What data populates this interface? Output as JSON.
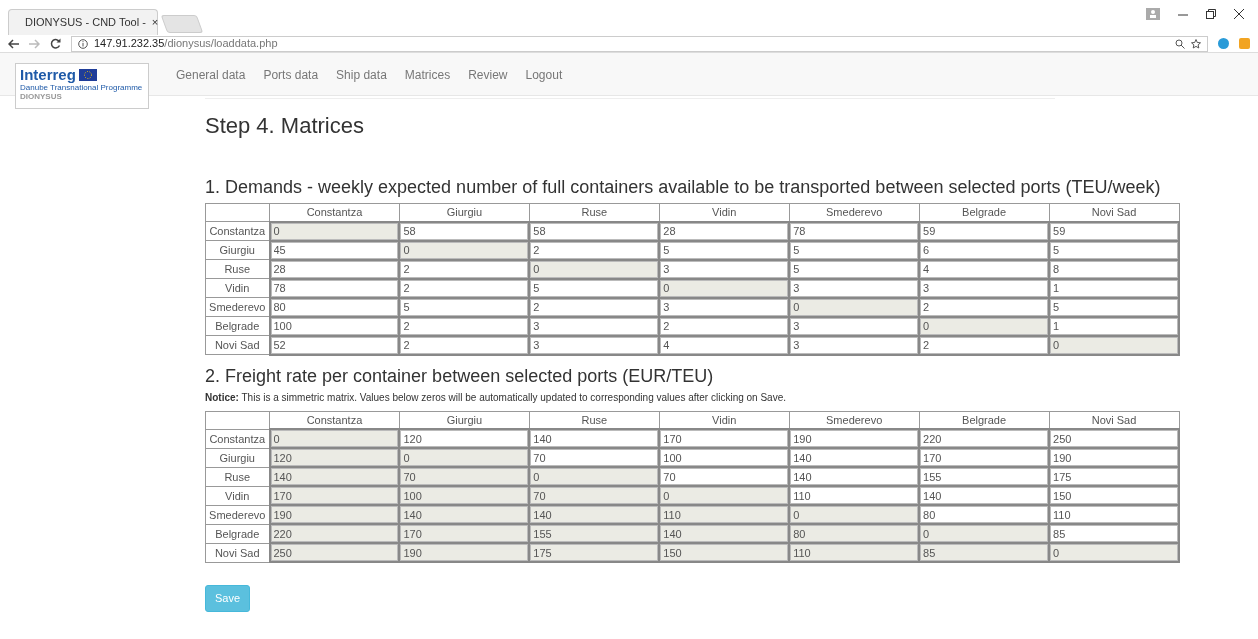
{
  "browser": {
    "tab_title": "DIONYSUS - CND Tool -",
    "tab_close": "×",
    "url_host": "147.91.232.35",
    "url_path": "/dionysus/loaddata.php"
  },
  "logo": {
    "name": "Interreg",
    "programme": "Danube Transnational Programme",
    "project": "DIONYSUS"
  },
  "nav": [
    {
      "label": "General data"
    },
    {
      "label": "Ports data"
    },
    {
      "label": "Ship data"
    },
    {
      "label": "Matrices"
    },
    {
      "label": "Review"
    },
    {
      "label": "Logout"
    }
  ],
  "page_title": "Step 4. Matrices",
  "sections": [
    {
      "heading": "1. Demands - weekly expected number of full containers available to be transported between selected ports (TEU/week)",
      "columns": [
        "Constantza",
        "Giurgiu",
        "Ruse",
        "Vidin",
        "Smederevo",
        "Belgrade",
        "Novi Sad"
      ],
      "rows": [
        {
          "label": "Constantza",
          "cells": [
            {
              "value": "0",
              "disabled": true
            },
            {
              "value": "58",
              "disabled": false
            },
            {
              "value": "58",
              "disabled": false
            },
            {
              "value": "28",
              "disabled": false
            },
            {
              "value": "78",
              "disabled": false
            },
            {
              "value": "59",
              "disabled": false
            },
            {
              "value": "59",
              "disabled": false
            }
          ]
        },
        {
          "label": "Giurgiu",
          "cells": [
            {
              "value": "45",
              "disabled": false
            },
            {
              "value": "0",
              "disabled": true
            },
            {
              "value": "2",
              "disabled": false
            },
            {
              "value": "5",
              "disabled": false
            },
            {
              "value": "5",
              "disabled": false
            },
            {
              "value": "6",
              "disabled": false
            },
            {
              "value": "5",
              "disabled": false
            }
          ]
        },
        {
          "label": "Ruse",
          "cells": [
            {
              "value": "28",
              "disabled": false
            },
            {
              "value": "2",
              "disabled": false
            },
            {
              "value": "0",
              "disabled": true
            },
            {
              "value": "3",
              "disabled": false
            },
            {
              "value": "5",
              "disabled": false
            },
            {
              "value": "4",
              "disabled": false
            },
            {
              "value": "8",
              "disabled": false
            }
          ]
        },
        {
          "label": "Vidin",
          "cells": [
            {
              "value": "78",
              "disabled": false
            },
            {
              "value": "2",
              "disabled": false
            },
            {
              "value": "5",
              "disabled": false
            },
            {
              "value": "0",
              "disabled": true
            },
            {
              "value": "3",
              "disabled": false
            },
            {
              "value": "3",
              "disabled": false
            },
            {
              "value": "1",
              "disabled": false
            }
          ]
        },
        {
          "label": "Smederevo",
          "cells": [
            {
              "value": "80",
              "disabled": false
            },
            {
              "value": "5",
              "disabled": false
            },
            {
              "value": "2",
              "disabled": false
            },
            {
              "value": "3",
              "disabled": false
            },
            {
              "value": "0",
              "disabled": true
            },
            {
              "value": "2",
              "disabled": false
            },
            {
              "value": "5",
              "disabled": false
            }
          ]
        },
        {
          "label": "Belgrade",
          "cells": [
            {
              "value": "100",
              "disabled": false
            },
            {
              "value": "2",
              "disabled": false
            },
            {
              "value": "3",
              "disabled": false
            },
            {
              "value": "2",
              "disabled": false
            },
            {
              "value": "3",
              "disabled": false
            },
            {
              "value": "0",
              "disabled": true
            },
            {
              "value": "1",
              "disabled": false
            }
          ]
        },
        {
          "label": "Novi Sad",
          "cells": [
            {
              "value": "52",
              "disabled": false
            },
            {
              "value": "2",
              "disabled": false
            },
            {
              "value": "3",
              "disabled": false
            },
            {
              "value": "4",
              "disabled": false
            },
            {
              "value": "3",
              "disabled": false
            },
            {
              "value": "2",
              "disabled": false
            },
            {
              "value": "0",
              "disabled": true
            }
          ]
        }
      ]
    },
    {
      "heading": "2. Freight rate per container between selected ports (EUR/TEU)",
      "notice": "**Notice:** This is a simmetric matrix. Values below zeros will be automatically updated to corresponding values after clicking on Save.",
      "columns": [
        "Constantza",
        "Giurgiu",
        "Ruse",
        "Vidin",
        "Smederevo",
        "Belgrade",
        "Novi Sad"
      ],
      "rows": [
        {
          "label": "Constantza",
          "cells": [
            {
              "value": "0",
              "disabled": true
            },
            {
              "value": "120",
              "disabled": false
            },
            {
              "value": "140",
              "disabled": false
            },
            {
              "value": "170",
              "disabled": false
            },
            {
              "value": "190",
              "disabled": false
            },
            {
              "value": "220",
              "disabled": false
            },
            {
              "value": "250",
              "disabled": false
            }
          ]
        },
        {
          "label": "Giurgiu",
          "cells": [
            {
              "value": "120",
              "disabled": true
            },
            {
              "value": "0",
              "disabled": true
            },
            {
              "value": "70",
              "disabled": false
            },
            {
              "value": "100",
              "disabled": false
            },
            {
              "value": "140",
              "disabled": false
            },
            {
              "value": "170",
              "disabled": false
            },
            {
              "value": "190",
              "disabled": false
            }
          ]
        },
        {
          "label": "Ruse",
          "cells": [
            {
              "value": "140",
              "disabled": true
            },
            {
              "value": "70",
              "disabled": true
            },
            {
              "value": "0",
              "disabled": true
            },
            {
              "value": "70",
              "disabled": false
            },
            {
              "value": "140",
              "disabled": false
            },
            {
              "value": "155",
              "disabled": false
            },
            {
              "value": "175",
              "disabled": false
            }
          ]
        },
        {
          "label": "Vidin",
          "cells": [
            {
              "value": "170",
              "disabled": true
            },
            {
              "value": "100",
              "disabled": true
            },
            {
              "value": "70",
              "disabled": true
            },
            {
              "value": "0",
              "disabled": true
            },
            {
              "value": "110",
              "disabled": false
            },
            {
              "value": "140",
              "disabled": false
            },
            {
              "value": "150",
              "disabled": false
            }
          ]
        },
        {
          "label": "Smederevo",
          "cells": [
            {
              "value": "190",
              "disabled": true
            },
            {
              "value": "140",
              "disabled": true
            },
            {
              "value": "140",
              "disabled": true
            },
            {
              "value": "110",
              "disabled": true
            },
            {
              "value": "0",
              "disabled": true
            },
            {
              "value": "80",
              "disabled": false
            },
            {
              "value": "110",
              "disabled": false
            }
          ]
        },
        {
          "label": "Belgrade",
          "cells": [
            {
              "value": "220",
              "disabled": true
            },
            {
              "value": "170",
              "disabled": true
            },
            {
              "value": "155",
              "disabled": true
            },
            {
              "value": "140",
              "disabled": true
            },
            {
              "value": "80",
              "disabled": true
            },
            {
              "value": "0",
              "disabled": true
            },
            {
              "value": "85",
              "disabled": false
            }
          ]
        },
        {
          "label": "Novi Sad",
          "cells": [
            {
              "value": "250",
              "disabled": true
            },
            {
              "value": "190",
              "disabled": true
            },
            {
              "value": "175",
              "disabled": true
            },
            {
              "value": "150",
              "disabled": true
            },
            {
              "value": "110",
              "disabled": true
            },
            {
              "value": "85",
              "disabled": true
            },
            {
              "value": "0",
              "disabled": true
            }
          ]
        }
      ]
    }
  ],
  "save_button": "Save"
}
